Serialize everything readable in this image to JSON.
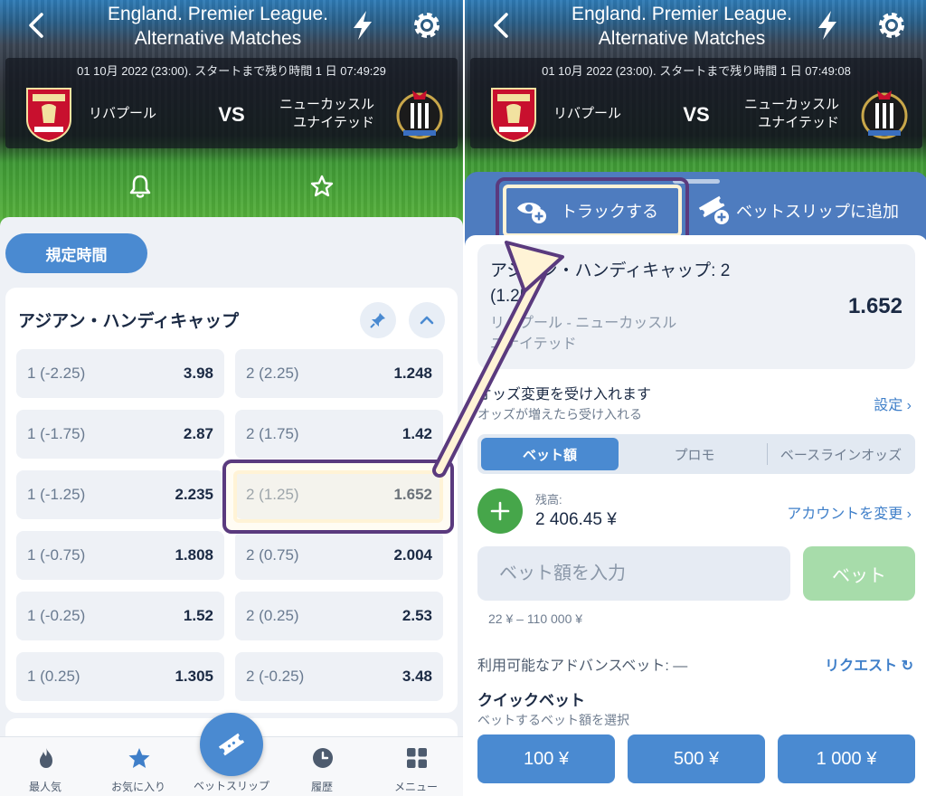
{
  "header": {
    "title_line1": "England. Premier League.",
    "title_line2": "Alternative Matches"
  },
  "match": {
    "kickoff_left": "01 10月 2022 (23:00). スタートまで残り時間 1 日 07:49:29",
    "kickoff_right": "01 10月 2022 (23:00). スタートまで残り時間 1 日 07:49:08",
    "home_team": "リバプール",
    "away_team_line1": "ニューカッスル",
    "away_team_line2": "ユナイテッド",
    "vs": "VS"
  },
  "left": {
    "period_tab": "規定時間",
    "market_title": "アジアン・ハンディキャップ",
    "odds": [
      {
        "label": "1 (-2.25)",
        "value": "3.98"
      },
      {
        "label": "2 (2.25)",
        "value": "1.248"
      },
      {
        "label": "1 (-1.75)",
        "value": "2.87"
      },
      {
        "label": "2 (1.75)",
        "value": "1.42"
      },
      {
        "label": "1 (-1.25)",
        "value": "2.235"
      },
      {
        "label": "2 (1.25)",
        "value": "1.652"
      },
      {
        "label": "1 (-0.75)",
        "value": "1.808"
      },
      {
        "label": "2 (0.75)",
        "value": "2.004"
      },
      {
        "label": "1 (-0.25)",
        "value": "1.52"
      },
      {
        "label": "2 (0.25)",
        "value": "2.53"
      },
      {
        "label": "1 (0.25)",
        "value": "1.305"
      },
      {
        "label": "2 (-0.25)",
        "value": "3.48"
      }
    ]
  },
  "bottom_nav": {
    "popular": "最人気",
    "favorites": "お気に入り",
    "betslip": "ベットスリップ",
    "history": "履歴",
    "menu": "メニュー"
  },
  "right": {
    "track_label": "トラックする",
    "add_to_slip_label": "ベットスリップに追加",
    "selection_market_line1": "アジアン・ハンディキャップ: 2",
    "selection_market_line2": "(1.25)",
    "selection_teams_line1": "リバプール - ニューカッスル",
    "selection_teams_line2": "ユナイテッド",
    "selection_odd": "1.652",
    "accept_title": "オッズ変更を受け入れます",
    "accept_sub": "オッズが増えたら受け入れる",
    "settings_link": "設定",
    "seg_stake": "ベット額",
    "seg_promo": "プロモ",
    "seg_baseline": "ベースラインオッズ",
    "balance_label": "残高:",
    "balance_value": "2 406.45 ¥",
    "change_account": "アカウントを変更",
    "amount_placeholder": "ベット額を入力",
    "bet_button": "ベット",
    "range": "22 ¥ – 110 000 ¥",
    "advance_label": "利用可能なアドバンスベット: —",
    "request_link": "リクエスト",
    "quick_title": "クイックベット",
    "quick_sub": "ベットするベット額を選択",
    "quick_amounts": [
      "100 ¥",
      "500 ¥",
      "1 000 ¥"
    ]
  },
  "colors": {
    "accent_blue": "#4a8ad1",
    "highlight_border": "#5a3a7e",
    "highlight_inner": "#fff3d6",
    "success_green": "#46a64a"
  }
}
